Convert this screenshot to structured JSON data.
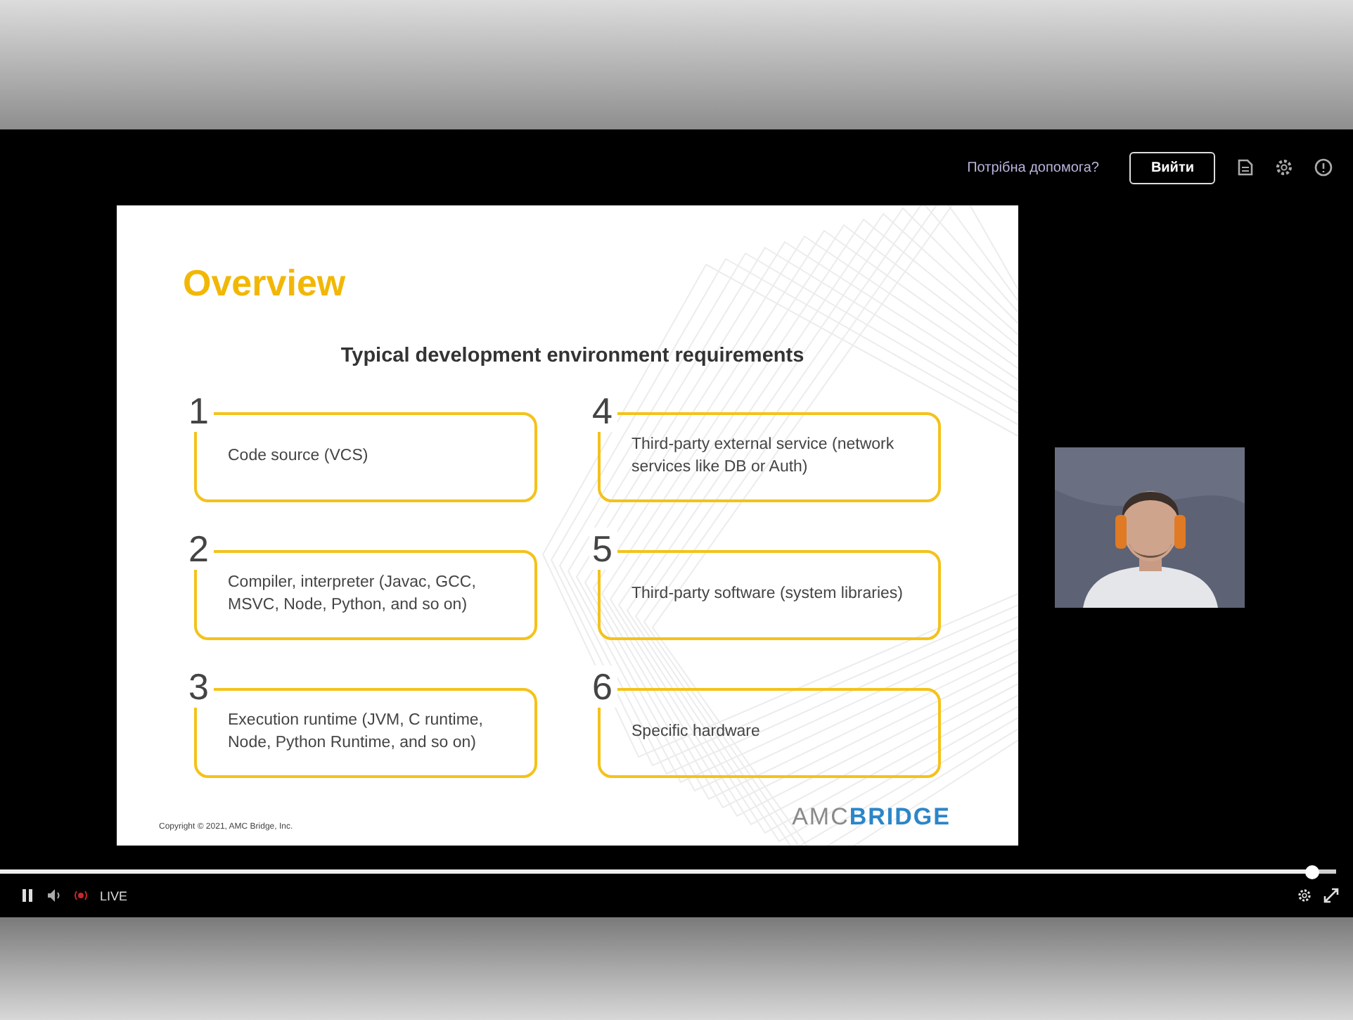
{
  "header": {
    "help_link": "Потрібна допомога?",
    "login_button": "Вийти"
  },
  "slide": {
    "title": "Overview",
    "subtitle": "Typical development environment requirements",
    "items": [
      {
        "number": "1",
        "text": "Code source (VCS)"
      },
      {
        "number": "2",
        "text": "Compiler, interpreter (Javac, GCC, MSVC, Node, Python, and so on)"
      },
      {
        "number": "3",
        "text": "Execution runtime (JVM, C runtime, Node, Python Runtime, and so on)"
      },
      {
        "number": "4",
        "text": "Third-party external service (network services like DB or Auth)"
      },
      {
        "number": "5",
        "text": "Third-party software (system libraries)"
      },
      {
        "number": "6",
        "text": "Specific hardware"
      }
    ],
    "copyright": "Copyright © 2021, AMC Bridge, Inc.",
    "logo": {
      "prefix": "AMC",
      "suffix": "BRIDGE"
    }
  },
  "player": {
    "progress": {
      "level": 0.982
    },
    "live_label": "LIVE"
  }
}
